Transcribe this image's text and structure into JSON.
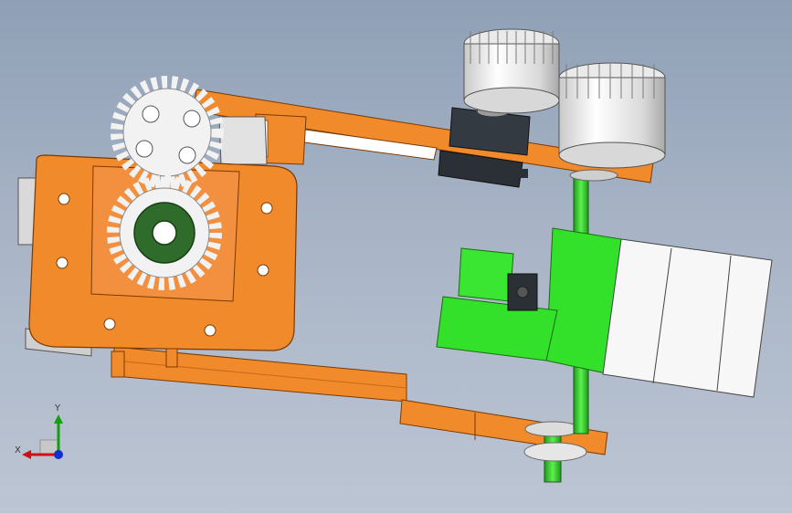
{
  "triad": {
    "x_label": "X",
    "y_label": "Y"
  },
  "colors": {
    "background_top": "#8fa0b6",
    "background_bottom": "#bcc5d3",
    "frame_orange": "#f08a2a",
    "frame_orange_dark": "#c8681a",
    "bracket_green": "#33e02a",
    "gear_white": "#f2f2f2",
    "bearing_green": "#2f6b2a",
    "servo_dark": "#2b2f36",
    "motor_white": "#f7f7f7",
    "shaft_green": "#2fcf2a",
    "axis_x": "#d01010",
    "axis_y": "#10a010",
    "axis_z": "#1030d0"
  },
  "icons": {
    "triad": "coordinate-triad-icon"
  }
}
